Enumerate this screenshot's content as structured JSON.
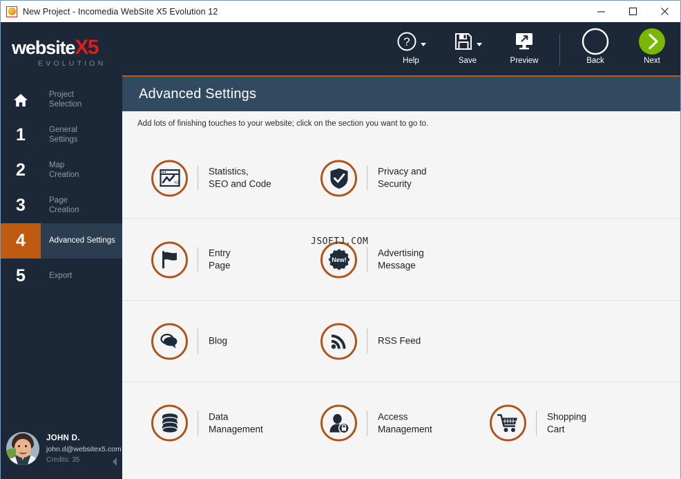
{
  "window": {
    "title": "New Project - Incomedia WebSite X5 Evolution 12",
    "app_icon": "websitex5-app-icon",
    "controls": [
      {
        "name": "minimize",
        "glyph": "minimize-icon"
      },
      {
        "name": "maximize",
        "glyph": "maximize-icon"
      },
      {
        "name": "close",
        "glyph": "close-icon"
      }
    ]
  },
  "brand": {
    "line1_main": "website",
    "line1_accent": "X5",
    "line2": "EVOLUTION",
    "accent_color": "#e01b1b"
  },
  "toolbar": {
    "items": [
      {
        "label": "Help",
        "icon": "help-question-icon",
        "has_dropdown": true
      },
      {
        "label": "Save",
        "icon": "floppy-disk-icon",
        "has_dropdown": true
      },
      {
        "label": "Preview",
        "icon": "monitor-preview-icon",
        "has_dropdown": false
      }
    ],
    "nav": [
      {
        "label": "Back",
        "icon": "chevron-left-circle-icon",
        "style": "outline"
      },
      {
        "label": "Next",
        "icon": "chevron-right-circle-icon",
        "style": "filled-green",
        "color": "#7ab800"
      }
    ]
  },
  "sidebar": {
    "items": [
      {
        "num": "home",
        "icon": "home-icon",
        "label": "Project\nSelection",
        "active": false
      },
      {
        "num": "1",
        "label": "General\nSettings",
        "active": false
      },
      {
        "num": "2",
        "label": "Map\nCreation",
        "active": false
      },
      {
        "num": "3",
        "label": "Page\nCreation",
        "active": false
      },
      {
        "num": "4",
        "label": "Advanced Settings",
        "active": true
      },
      {
        "num": "5",
        "label": "Export",
        "active": false
      }
    ],
    "active_color": "#bf5a11",
    "user": {
      "name": "JOHN D.",
      "email": "john.d@websitex5.com",
      "credits": "Credits: 35",
      "avatar": "user-avatar-photo",
      "collapse": "collapse-sidebar-arrow"
    }
  },
  "page": {
    "title": "Advanced Settings",
    "subtitle": "Add lots of finishing touches to your website; click on the section you want to go to.",
    "accent_color": "#b0551a",
    "rows": [
      [
        {
          "label": "Statistics,\nSEO and Code",
          "icon": "statistics-seo-code-icon"
        },
        {
          "label": "Privacy and\nSecurity",
          "icon": "shield-check-icon"
        }
      ],
      [
        {
          "label": "Entry\nPage",
          "icon": "flag-icon"
        },
        {
          "label": "Advertising\nMessage",
          "icon": "new-badge-icon"
        }
      ],
      [
        {
          "label": "Blog",
          "icon": "speech-bubbles-icon"
        },
        {
          "label": "RSS Feed",
          "icon": "rss-feed-icon"
        }
      ],
      [
        {
          "label": "Data\nManagement",
          "icon": "database-icon"
        },
        {
          "label": "Access\nManagement",
          "icon": "user-lock-icon"
        },
        {
          "label": "Shopping\nCart",
          "icon": "shopping-cart-icon"
        }
      ]
    ]
  },
  "watermark": {
    "text": "JSOFTJ.COM"
  }
}
